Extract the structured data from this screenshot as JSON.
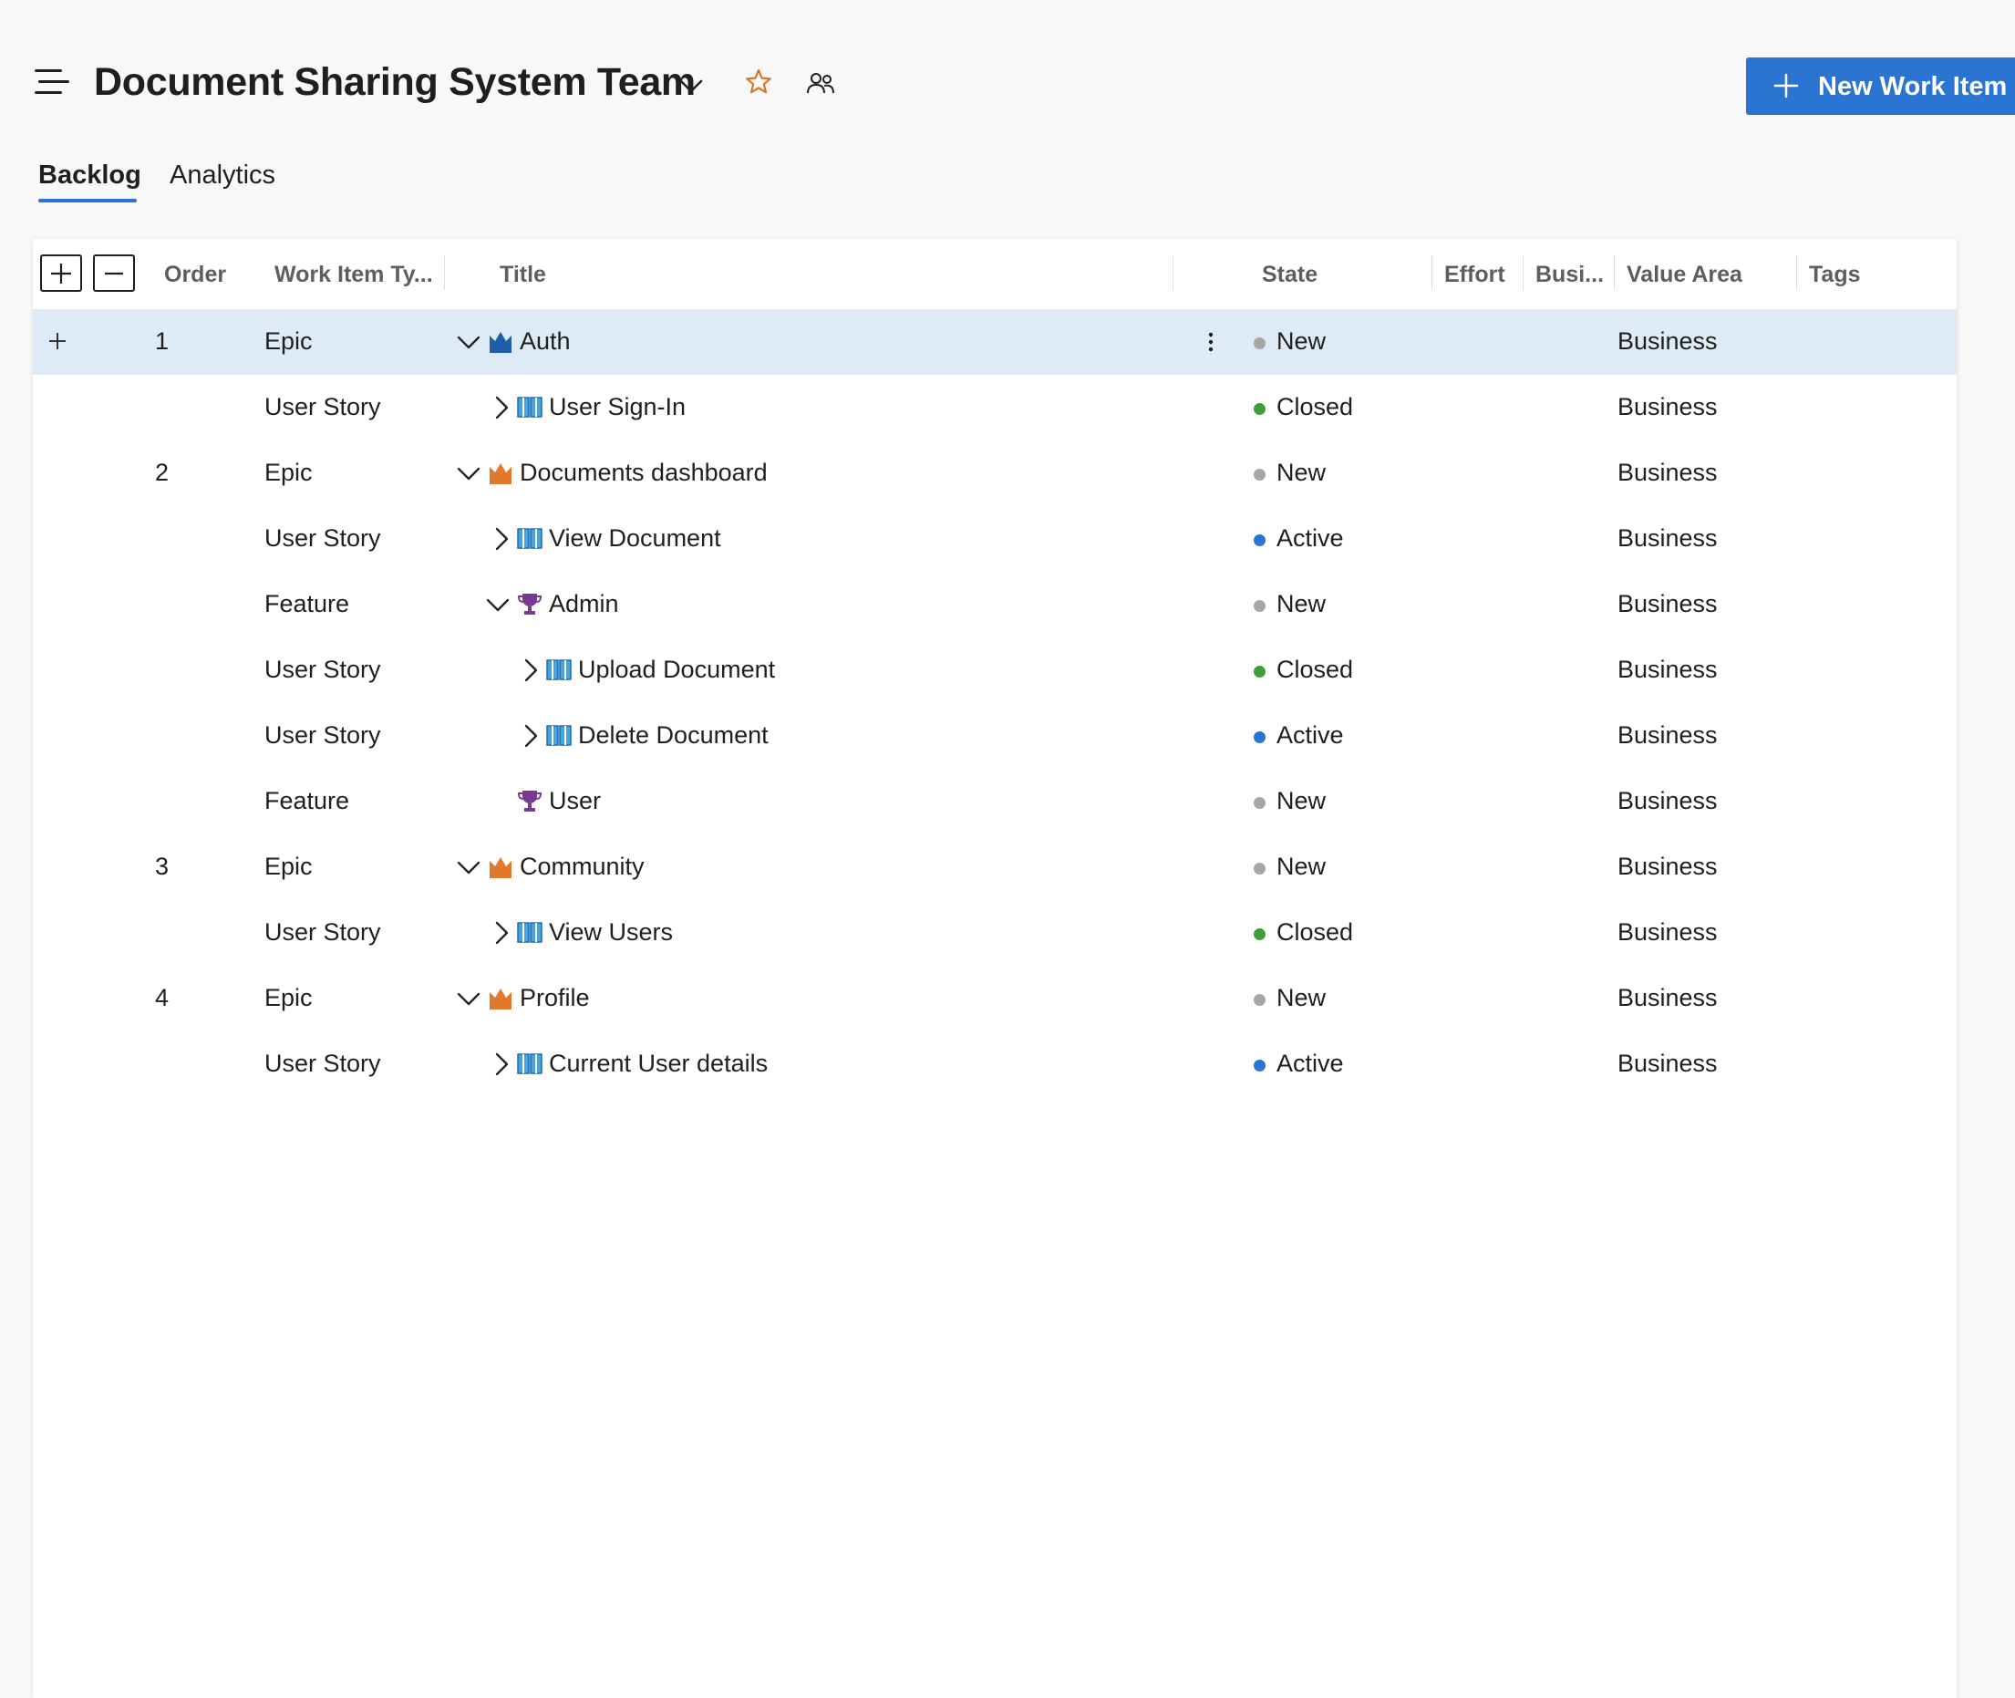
{
  "header": {
    "title": "Document Sharing System Team",
    "new_button_label": "New Work Item",
    "accent_color": "#2b74d1"
  },
  "tabs": [
    {
      "label": "Backlog",
      "selected": true
    },
    {
      "label": "Analytics",
      "selected": false
    }
  ],
  "columns": {
    "order": "Order",
    "type": "Work Item Ty...",
    "title": "Title",
    "state": "State",
    "effort": "Effort",
    "business": "Busi...",
    "value_area": "Value Area",
    "tags": "Tags"
  },
  "state_colors": {
    "New": "#a6a6a6",
    "Closed": "#3e9c3a",
    "Active": "#2b74d1"
  },
  "rows": [
    {
      "order": "1",
      "type": "Epic",
      "title": "Auth",
      "state": "New",
      "value_area": "Business",
      "icon": "crown-icon",
      "expander": "expanded",
      "selected": true
    },
    {
      "order": "",
      "type": "User Story",
      "title": "User Sign-In",
      "state": "Closed",
      "value_area": "Business",
      "icon": "book-icon",
      "expander": "collapsed"
    },
    {
      "order": "2",
      "type": "Epic",
      "title": "Documents dashboard",
      "state": "New",
      "value_area": "Business",
      "icon": "crown-icon",
      "expander": "expanded"
    },
    {
      "order": "",
      "type": "User Story",
      "title": "View Document",
      "state": "Active",
      "value_area": "Business",
      "icon": "book-icon",
      "expander": "collapsed"
    },
    {
      "order": "",
      "type": "Feature",
      "title": "Admin",
      "state": "New",
      "value_area": "Business",
      "icon": "trophy-icon",
      "expander": "expanded"
    },
    {
      "order": "",
      "type": "User Story",
      "title": "Upload Document",
      "state": "Closed",
      "value_area": "Business",
      "icon": "book-icon",
      "expander": "collapsed"
    },
    {
      "order": "",
      "type": "User Story",
      "title": "Delete Document",
      "state": "Active",
      "value_area": "Business",
      "icon": "book-icon",
      "expander": "collapsed"
    },
    {
      "order": "",
      "type": "Feature",
      "title": "User",
      "state": "New",
      "value_area": "Business",
      "icon": "trophy-icon",
      "expander": "none"
    },
    {
      "order": "3",
      "type": "Epic",
      "title": "Community",
      "state": "New",
      "value_area": "Business",
      "icon": "crown-icon",
      "expander": "expanded"
    },
    {
      "order": "",
      "type": "User Story",
      "title": "View Users",
      "state": "Closed",
      "value_area": "Business",
      "icon": "book-icon",
      "expander": "collapsed"
    },
    {
      "order": "4",
      "type": "Epic",
      "title": "Profile",
      "state": "New",
      "value_area": "Business",
      "icon": "crown-icon",
      "expander": "expanded"
    },
    {
      "order": "",
      "type": "User Story",
      "title": "Current User details",
      "state": "Active",
      "value_area": "Business",
      "icon": "book-icon",
      "expander": "collapsed"
    }
  ]
}
